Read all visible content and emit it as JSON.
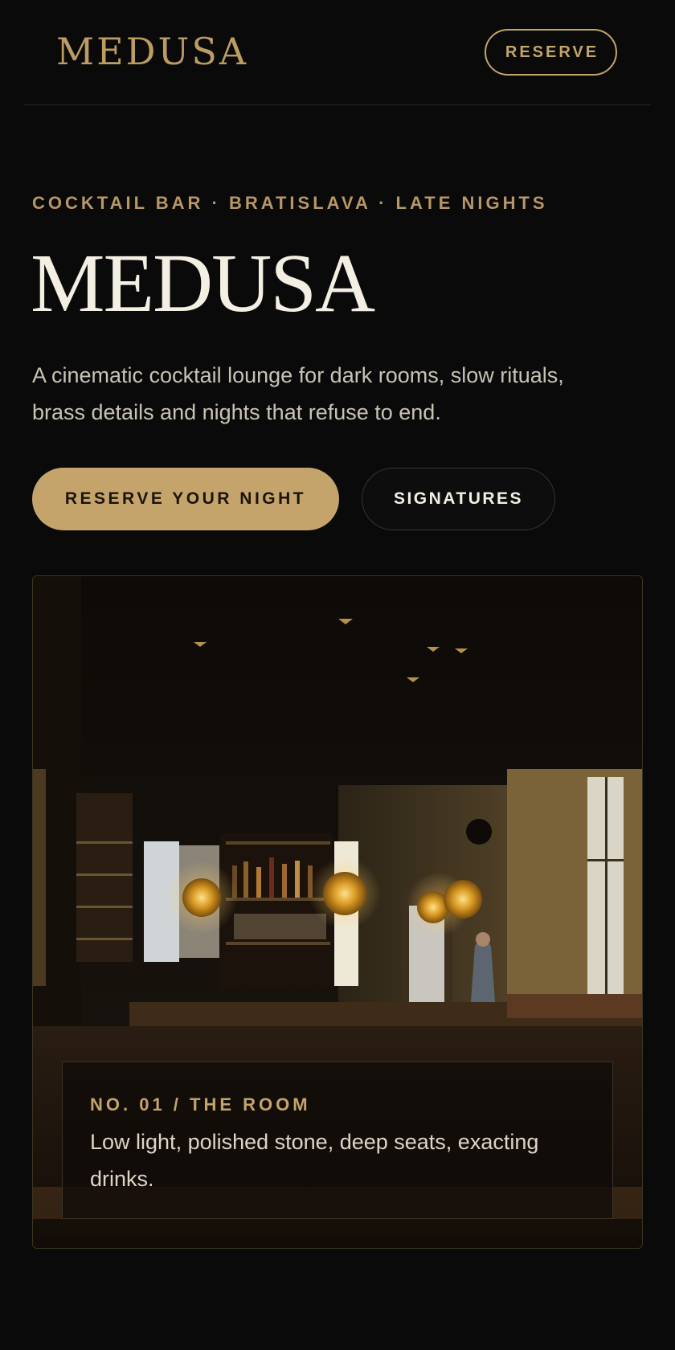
{
  "header": {
    "logo": "MEDUSA",
    "reserve_label": "RESERVE"
  },
  "hero": {
    "eyebrow": "COCKTAIL BAR · BRATISLAVA · LATE NIGHTS",
    "title": "MEDUSA",
    "description": "A cinematic cocktail lounge for dark rooms, slow rituals, brass details and nights that refuse to end.",
    "primary_button": "RESERVE YOUR NIGHT",
    "secondary_button": "SIGNATURES"
  },
  "feature": {
    "kicker": "NO. 01 / THE ROOM",
    "caption": "Low light, polished stone, deep seats, exacting drinks."
  },
  "colors": {
    "background": "#0a0a0a",
    "gold_accent": "#c4a46b",
    "heading_ivory": "#f4efe3"
  }
}
